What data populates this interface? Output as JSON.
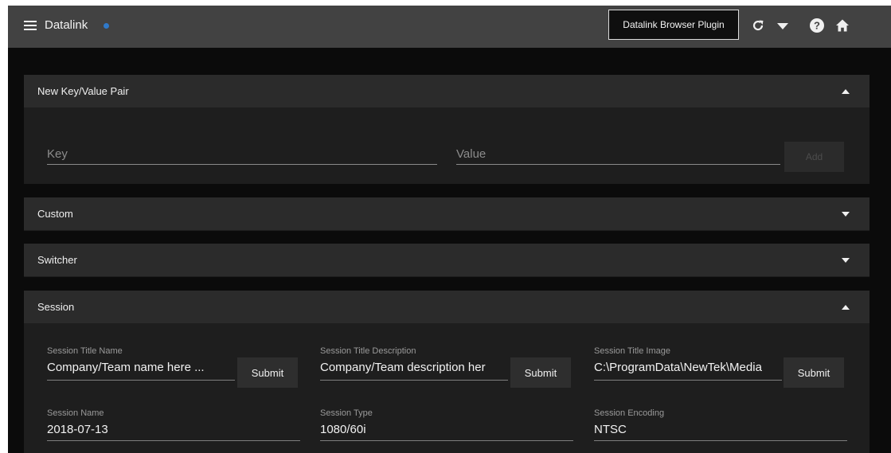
{
  "header": {
    "menu_icon": "hamburger-menu-icon",
    "title": "Datalink",
    "status_dot_color": "#2f79c9",
    "plugin_button_label": "Datalink Browser Plugin",
    "icons": [
      "refresh-icon",
      "dropdown-caret-icon",
      "help-icon",
      "home-icon"
    ]
  },
  "panels": {
    "new_pair": {
      "title": "New Key/Value Pair",
      "expanded": true,
      "key_placeholder": "Key",
      "value_placeholder": "Value",
      "add_label": "Add"
    },
    "custom": {
      "title": "Custom",
      "expanded": false
    },
    "switcher": {
      "title": "Switcher",
      "expanded": false
    },
    "session": {
      "title": "Session",
      "expanded": true,
      "submit_label": "Submit",
      "fields": {
        "title_name": {
          "label": "Session Title Name",
          "value": "Company/Team name here ..."
        },
        "title_description": {
          "label": "Session Title Description",
          "value": "Company/Team description her"
        },
        "title_image": {
          "label": "Session Title Image",
          "value": "C:\\ProgramData\\NewTek\\Media"
        },
        "name": {
          "label": "Session Name",
          "value": "2018-07-13"
        },
        "type": {
          "label": "Session Type",
          "value": "1080/60i"
        },
        "encoding": {
          "label": "Session Encoding",
          "value": "NTSC"
        }
      }
    }
  },
  "colors": {
    "topbar": "#424242",
    "background": "#0b0b0b",
    "panel_header": "#2b2b2b",
    "panel_body": "#1e1e1e",
    "accent": "#2f79c9"
  }
}
